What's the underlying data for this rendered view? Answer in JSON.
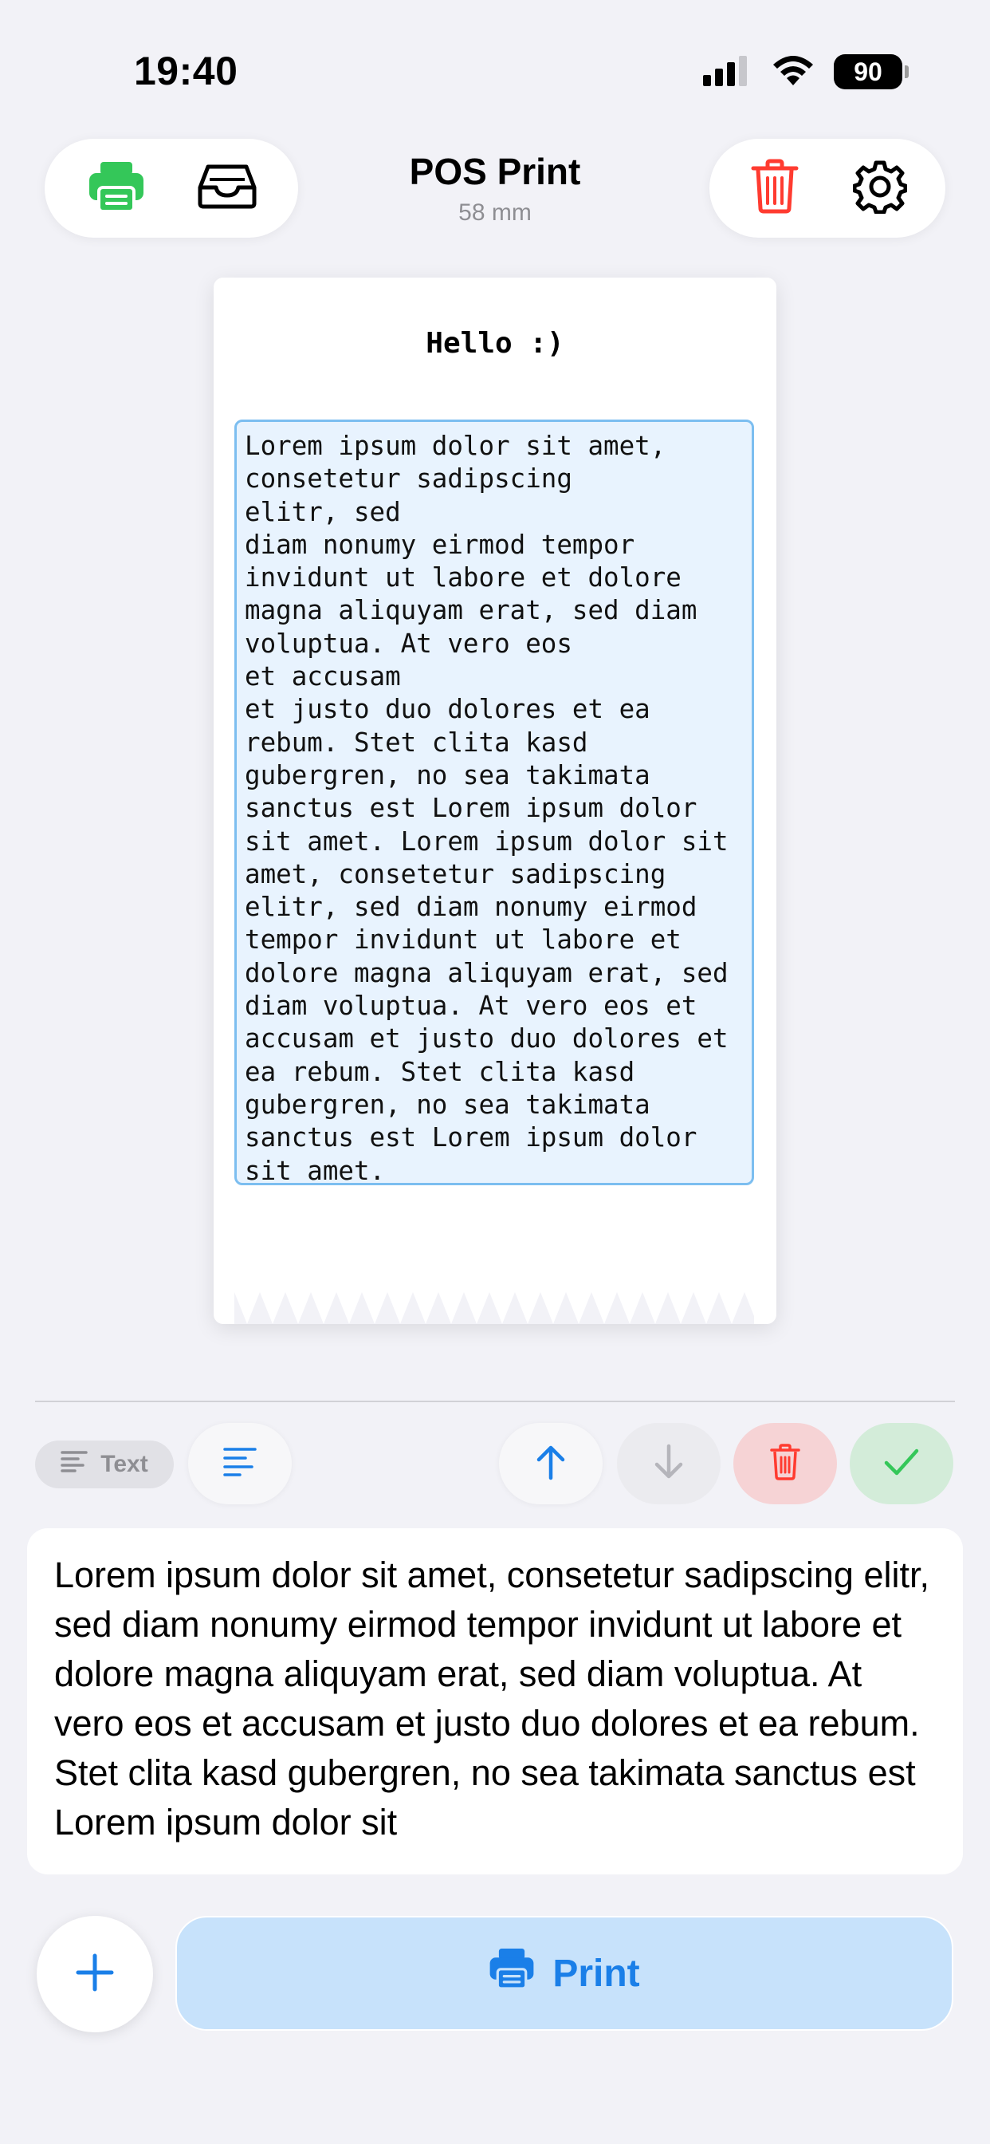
{
  "status_bar": {
    "time": "19:40",
    "battery": "90",
    "icons": [
      "cellular-signal-icon",
      "wifi-icon",
      "battery-icon"
    ]
  },
  "nav": {
    "title": "POS Print",
    "subtitle": "58 mm",
    "left_icons": [
      "printer-icon",
      "inbox-tray-icon"
    ],
    "right_icons": [
      "trash-icon",
      "gear-icon"
    ]
  },
  "receipt": {
    "title": "Hello :)",
    "text_block": "Lorem ipsum dolor sit amet,\nconsetetur sadipscing\nelitr, sed\ndiam nonumy eirmod tempor\ninvidunt ut labore et dolore\nmagna aliquyam erat, sed diam\nvoluptua. At vero eos\net accusam\net justo duo dolores et ea\nrebum. Stet clita kasd\ngubergren, no sea takimata\nsanctus est Lorem ipsum dolor\nsit amet. Lorem ipsum dolor sit\namet, consetetur sadipscing\nelitr, sed diam nonumy eirmod\ntempor invidunt ut labore et\ndolore magna aliquyam erat, sed\ndiam voluptua. At vero eos et\naccusam et justo duo dolores et\nea rebum. Stet clita kasd\ngubergren, no sea takimata\nsanctus est Lorem ipsum dolor\nsit amet."
  },
  "toolbar": {
    "type_label": "Text",
    "buttons": [
      "align-left-icon",
      "arrow-up-icon",
      "arrow-down-icon",
      "trash-icon",
      "checkmark-icon"
    ]
  },
  "editor": {
    "text": "Lorem ipsum dolor sit amet, consetetur sadipscing elitr, sed diam nonumy eirmod tempor invidunt ut labore et dolore magna aliquyam erat, sed diam voluptua. At vero eos et accusam et justo duo dolores et ea rebum. Stet clita kasd gubergren, no sea takimata sanctus est Lorem ipsum dolor sit"
  },
  "bottom": {
    "print_label": "Print"
  },
  "colors": {
    "accent": "#1a7fe8",
    "printer_green": "#34c759",
    "destructive": "#ff3b30",
    "selection_border": "#7cbef0",
    "selection_fill": "#e8f3fe"
  }
}
